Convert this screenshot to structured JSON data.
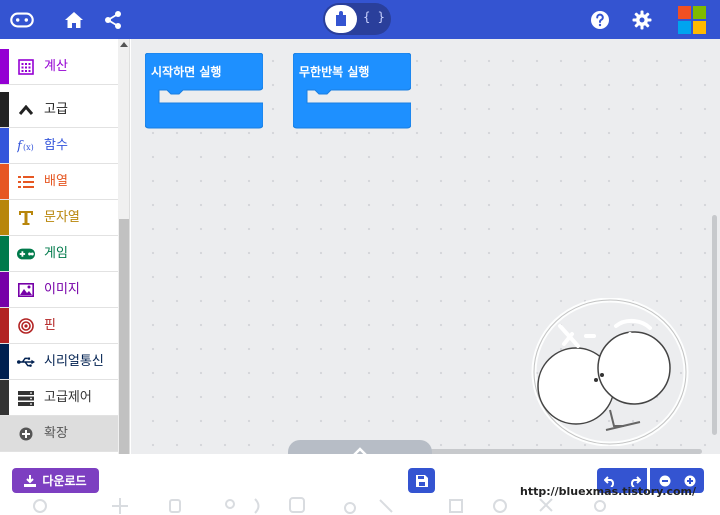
{
  "toolbox": {
    "items": [
      {
        "label": "계산",
        "color": "#9400d3",
        "text_color": "#9400d3",
        "icon": "calculator-icon"
      },
      {
        "label": "고급",
        "color": "#222222",
        "text_color": "#222222",
        "icon": "chevron-up-icon"
      },
      {
        "label": "함수",
        "color": "#3455db",
        "text_color": "#3455db",
        "icon": "function-icon"
      },
      {
        "label": "배열",
        "color": "#e65722",
        "text_color": "#e65722",
        "icon": "list-icon"
      },
      {
        "label": "문자열",
        "color": "#b8860b",
        "text_color": "#b8860b",
        "icon": "text-icon"
      },
      {
        "label": "게임",
        "color": "#007a4b",
        "text_color": "#007a4b",
        "icon": "gamepad-icon"
      },
      {
        "label": "이미지",
        "color": "#7600a8",
        "text_color": "#7600a8",
        "icon": "image-icon"
      },
      {
        "label": "핀",
        "color": "#b22222",
        "text_color": "#b22222",
        "icon": "target-icon"
      },
      {
        "label": "시리얼통신",
        "color": "#002050",
        "text_color": "#002050",
        "icon": "usb-icon"
      },
      {
        "label": "고급제어",
        "color": "#333333",
        "text_color": "#333333",
        "icon": "server-icon"
      },
      {
        "label": "확장",
        "color": "#dddddd",
        "text_color": "#555555",
        "icon": "plus-circle-icon"
      }
    ]
  },
  "editor": {
    "mode_javascript": "{ }"
  },
  "blocks": {
    "on_start": "시작하면 실행",
    "forever": "무한반복 실행",
    "color": "#1e90ff"
  },
  "bottom": {
    "download_label": "다운로드",
    "footer_url": "http://bluexmas.tistory.com/"
  },
  "colors": {
    "topbar": "#3454d1",
    "workspace": "#ecedef",
    "download": "#7d3fc1",
    "ms_red": "#f25022",
    "ms_green": "#7fba00",
    "ms_blue": "#00a4ef",
    "ms_yellow": "#ffb900"
  }
}
